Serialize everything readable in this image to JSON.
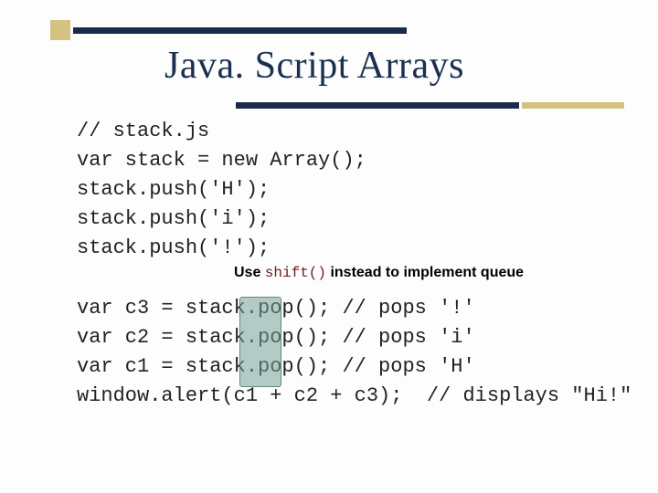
{
  "title": "Java. Script Arrays",
  "code_block_1": "// stack.js\nvar stack = new Array();\nstack.push('H');\nstack.push('i');\nstack.push('!');",
  "note_prefix": "Use ",
  "note_code": "shift()",
  "note_suffix": " instead to implement queue",
  "code_block_2": "var c3 = stack.pop(); // pops '!'\nvar c2 = stack.pop(); // pops 'i'\nvar c1 = stack.pop(); // pops 'H'\nwindow.alert(c1 + c2 + c3);  // displays \"Hi!\""
}
